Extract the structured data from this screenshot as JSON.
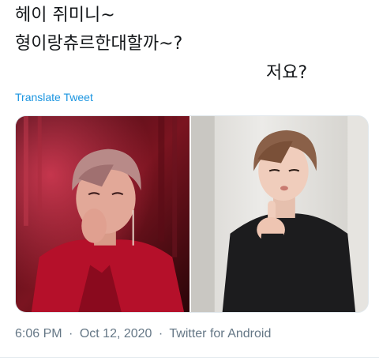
{
  "tweet": {
    "lines": [
      "헤이 쥐미니~",
      "형이랑츄르한대할까~?",
      "저요?"
    ],
    "translate_label": "Translate Tweet",
    "time": "6:06 PM",
    "date": "Oct 12, 2020",
    "separator": "·",
    "source": "Twitter for Android"
  },
  "colors": {
    "text": "#14171a",
    "link": "#1b95e0",
    "meta": "#657786",
    "border": "#e1e8ed"
  }
}
